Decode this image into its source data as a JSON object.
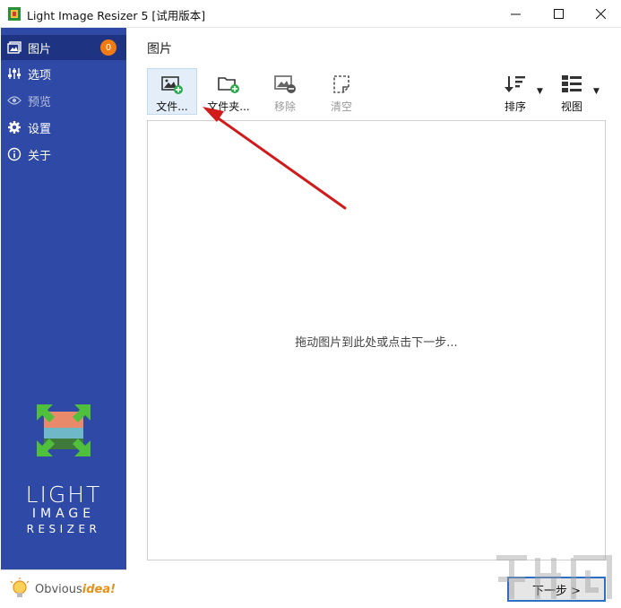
{
  "window": {
    "title": "Light Image Resizer 5  [试用版本]"
  },
  "sidebar": {
    "items": [
      {
        "label": "图片",
        "badge": "0"
      },
      {
        "label": "选项"
      },
      {
        "label": "预览"
      },
      {
        "label": "设置"
      },
      {
        "label": "关于"
      }
    ],
    "logo": {
      "line1": "LIGHT",
      "line2": "IMAGE",
      "line3": "RESIZER"
    },
    "brand": {
      "prefix": "Obvious",
      "suffix": "idea!"
    }
  },
  "main": {
    "title": "图片",
    "toolbar": {
      "files": "文件...",
      "folder": "文件夹...",
      "remove": "移除",
      "clear": "清空",
      "sort": "排序",
      "view": "视图"
    },
    "drop_hint": "拖动图片到此处或点击下一步...",
    "next_button": "下一步 >"
  },
  "colors": {
    "sidebar": "#2f49a6",
    "sidebar_active": "#1e3382",
    "badge": "#f07b12",
    "arrow": "#d11b1b"
  }
}
